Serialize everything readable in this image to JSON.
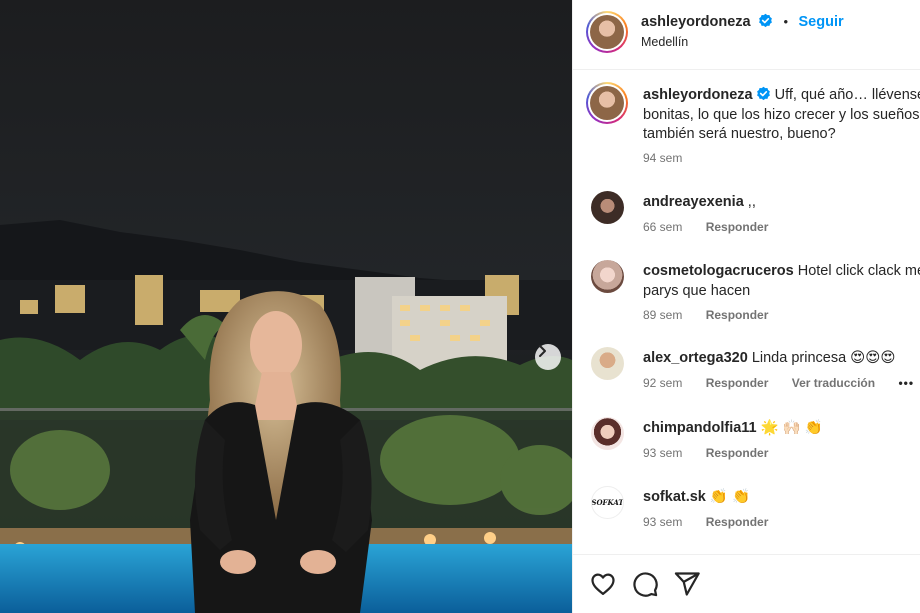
{
  "post": {
    "username": "ashleyordoneza",
    "follow_label": "Seguir",
    "separator": "•",
    "location": "Medellín",
    "caption_line1": "Uff, qué año… llévense c",
    "caption_line2": "bonitas, lo que los hizo crecer y los sueños",
    "caption_line3": "también será nuestro, bueno?",
    "caption_time": "94 sem"
  },
  "comments": [
    {
      "user": "andreayexenia",
      "text": ",,",
      "time": "66 sem",
      "reply": "Responder"
    },
    {
      "user": "cosmetologacruceros",
      "text": "Hotel click clack me",
      "text2": "parys que hacen",
      "time": "89 sem",
      "reply": "Responder"
    },
    {
      "user": "alex_ortega320",
      "text": "Linda princesa 😍😍😍",
      "time": "92 sem",
      "reply": "Responder",
      "translate": "Ver traducción",
      "more": "•••"
    },
    {
      "user": "chimpandolfia11",
      "text": "🌟 🙌🏻 👏",
      "time": "93 sem",
      "reply": "Responder"
    },
    {
      "user": "sofkat.sk",
      "text": "👏 👏",
      "time": "93 sem",
      "reply": "Responder",
      "avatar_text": "SOFKAT"
    }
  ],
  "colors": {
    "accent_blue": "#0095f6",
    "muted_text": "#737373",
    "primary_text": "#262626"
  },
  "icons": [
    "verified-badge-icon",
    "chevron-right-icon",
    "heart-icon",
    "comment-icon",
    "share-icon",
    "more-options-icon"
  ]
}
